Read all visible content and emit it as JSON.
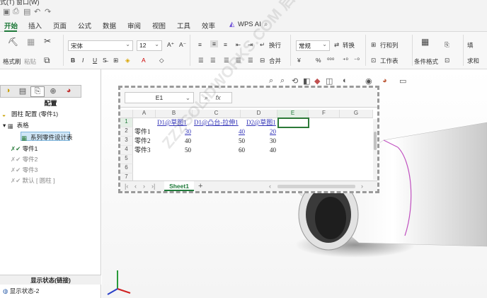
{
  "titlebar": {
    "menu_fragment": "式(T)   窗口(W)"
  },
  "ribbon_tabs": [
    {
      "label": "开始",
      "active": true
    },
    {
      "label": "插入"
    },
    {
      "label": "页面"
    },
    {
      "label": "公式"
    },
    {
      "label": "数据"
    },
    {
      "label": "审阅"
    },
    {
      "label": "视图"
    },
    {
      "label": "工具"
    },
    {
      "label": "效率"
    },
    {
      "label": "WPS AI"
    }
  ],
  "ribbon": {
    "format_painter": "格式刷",
    "paste": "粘贴",
    "font_name": "宋体",
    "font_size": "12",
    "wrap_text": "换行",
    "merge": "合并",
    "number_format": "常规",
    "convert": "转换",
    "rows_cols": "行和列",
    "worksheet": "工作表",
    "cond_format": "条件格式",
    "fill": "填",
    "sum": "求和"
  },
  "feature_manager": {
    "title": "配置",
    "root": "圆柱 配置 (零件1)",
    "table_node": "表格",
    "design_table": "系列零件设计表",
    "configs": [
      {
        "label": "零件1",
        "active": true
      },
      {
        "label": "零件2",
        "active": false
      },
      {
        "label": "零件3",
        "active": false
      },
      {
        "label": "默认 [ 圆柱 ]",
        "active": false
      }
    ],
    "display_state_title": "显示状态(链接)",
    "display_state": "显示状态-2"
  },
  "spreadsheet": {
    "name_box": "E1",
    "fx_label": "fx",
    "columns": [
      "A",
      "B",
      "C",
      "D",
      "E",
      "F",
      "G"
    ],
    "rows": [
      "1",
      "2",
      "3",
      "4",
      "5",
      "6",
      "7"
    ],
    "header_row": [
      "",
      "D1@草图1",
      "D1@凸台-拉伸1",
      "D2@草图1"
    ],
    "data_rows": [
      {
        "name": "零件1",
        "values": [
          "30",
          "40",
          "20"
        ],
        "linked": true
      },
      {
        "name": "零件2",
        "values": [
          "40",
          "50",
          "30"
        ],
        "linked": false
      },
      {
        "name": "零件3",
        "values": [
          "50",
          "60",
          "40"
        ],
        "linked": false
      }
    ],
    "active_sheet": "Sheet1",
    "add_sheet": "+"
  },
  "watermark": "ZZZSOLIDWORKS.COM 启德长大soldorks"
}
